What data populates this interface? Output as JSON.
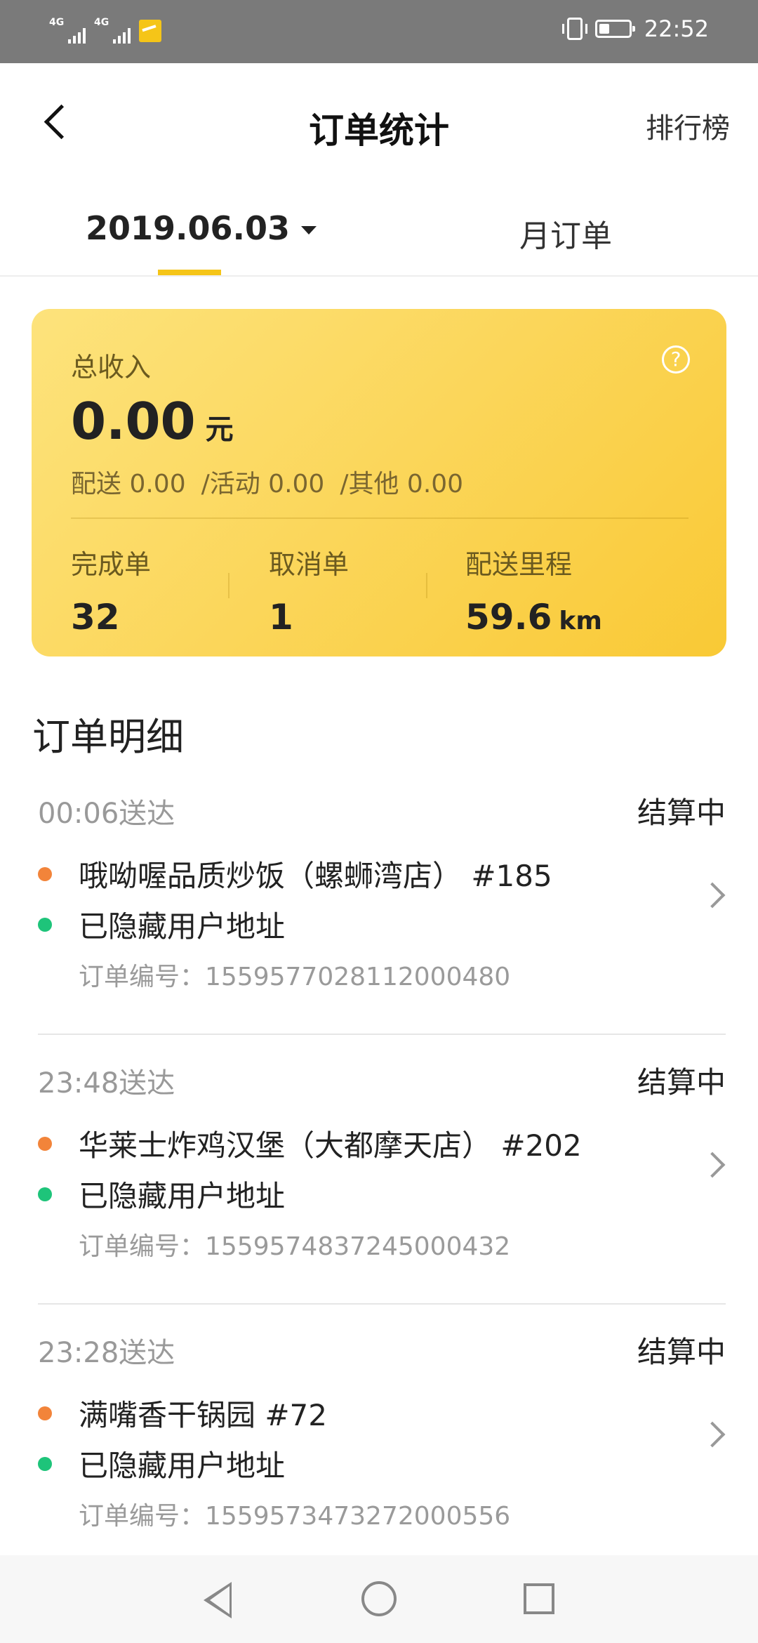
{
  "status_bar": {
    "network_1": "4G",
    "network_2": "4G",
    "time": "22:52"
  },
  "header": {
    "title": "订单统计",
    "ranking_label": "排行榜"
  },
  "tabs": {
    "date_label": "2019.06.03",
    "month_label": "月订单"
  },
  "summary": {
    "income_label": "总收入",
    "income_value": "0.00",
    "income_unit": "元",
    "breakdown": [
      "配送 0.00",
      "/活动 0.00",
      "/其他 0.00"
    ],
    "stats": [
      {
        "label": "完成单",
        "value": "32",
        "unit": ""
      },
      {
        "label": "取消单",
        "value": "1",
        "unit": ""
      },
      {
        "label": "配送里程",
        "value": "59.6",
        "unit": "km"
      }
    ]
  },
  "section_title": "订单明细",
  "orders": [
    {
      "time": "00:06送达",
      "status": "结算中",
      "store": "哦呦喔品质炒饭（螺蛳湾店） #185",
      "address": "已隐藏用户地址",
      "order_number": "订单编号：1559577028112000480"
    },
    {
      "time": "23:48送达",
      "status": "结算中",
      "store": "华莱士炸鸡汉堡（大都摩天店） #202",
      "address": "已隐藏用户地址",
      "order_number": "订单编号：1559574837245000432"
    },
    {
      "time": "23:28送达",
      "status": "结算中",
      "store": "满嘴香干锅园 #72",
      "address": "已隐藏用户地址",
      "order_number": "订单编号：1559573473272000556"
    }
  ],
  "colors": {
    "accent": "#f5c518",
    "pickup_dot": "#f2843a",
    "dropoff_dot": "#1ec47a"
  }
}
